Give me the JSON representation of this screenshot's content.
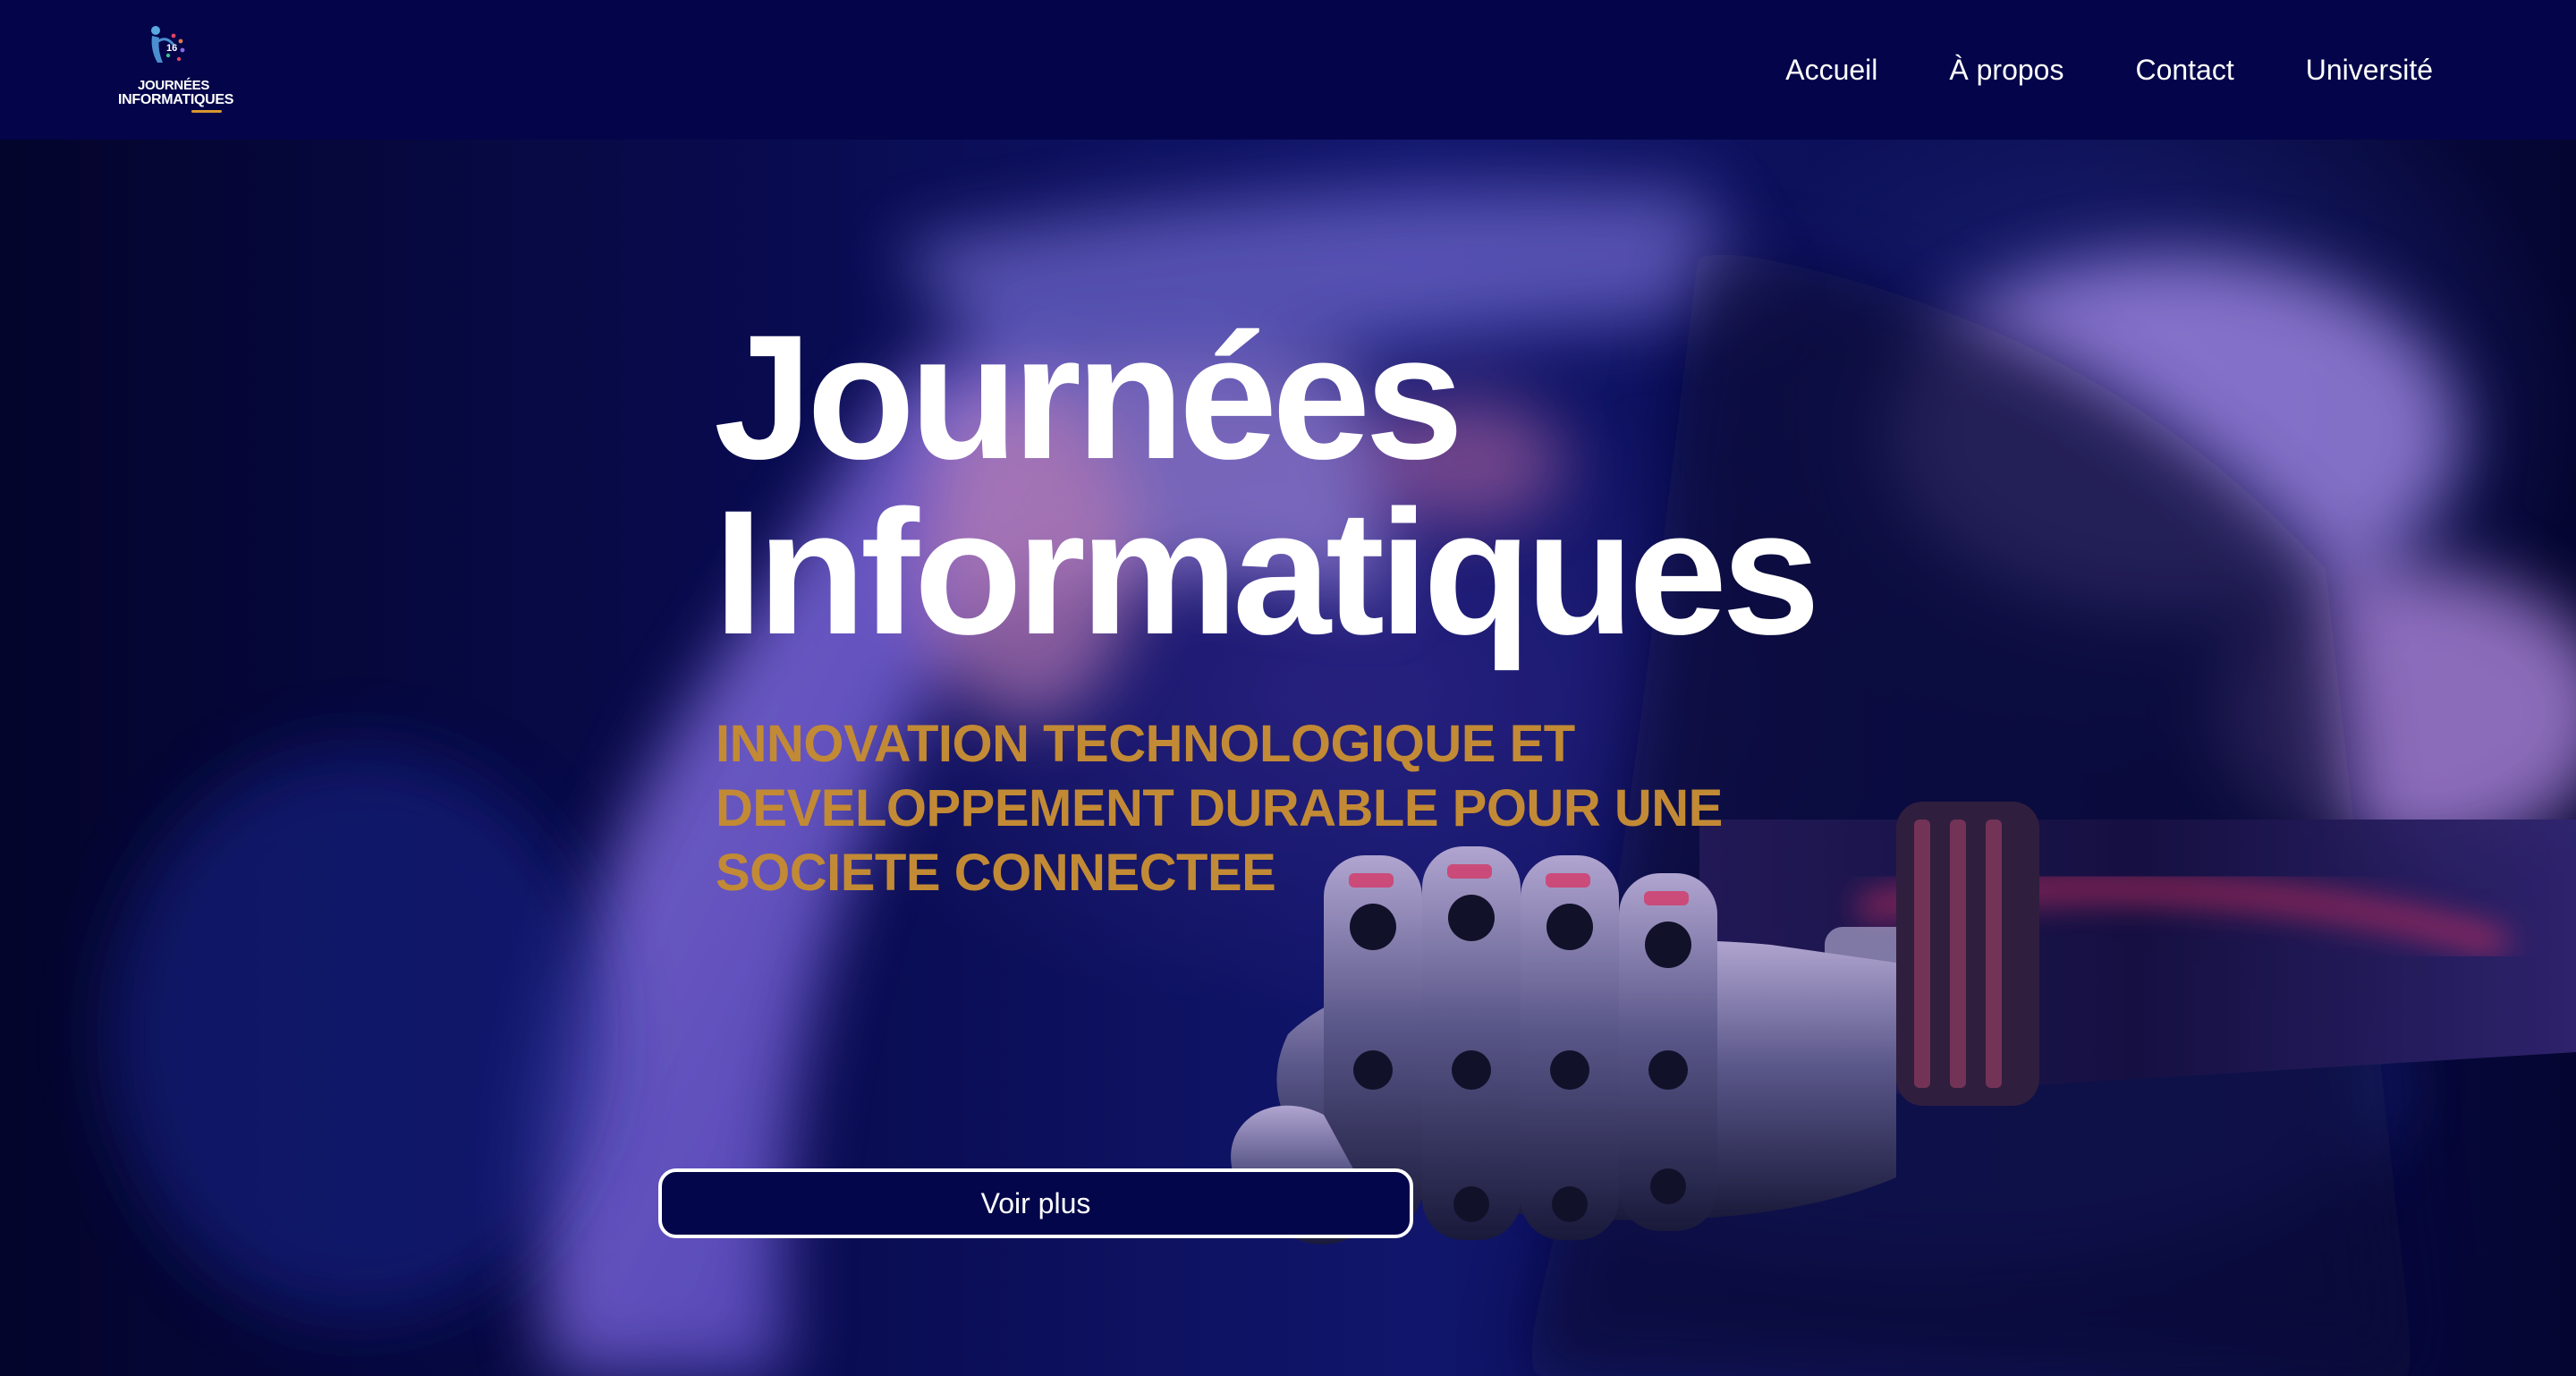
{
  "brand": {
    "logo_badge": "16",
    "logo_line1": "JOURNÉES",
    "logo_line2": "INFORMATIQUES"
  },
  "nav": {
    "items": [
      {
        "label": "Accueil"
      },
      {
        "label": "À propos"
      },
      {
        "label": "Contact"
      },
      {
        "label": "Université"
      }
    ]
  },
  "hero": {
    "title_line1": "Journées",
    "title_line2": "Informatiques",
    "subtitle_lines": [
      "INNOVATION TECHNOLOGIQUE ET",
      "DEVELOPPEMENT DURABLE POUR UNE",
      "SOCIETE CONNECTEE"
    ],
    "cta_label": "Voir plus"
  },
  "colors": {
    "navbar_bg": "#03044a",
    "accent_gold": "#c28a35",
    "text_white": "#ffffff"
  },
  "icons": {
    "logo": "person-figure-with-stars-icon"
  }
}
